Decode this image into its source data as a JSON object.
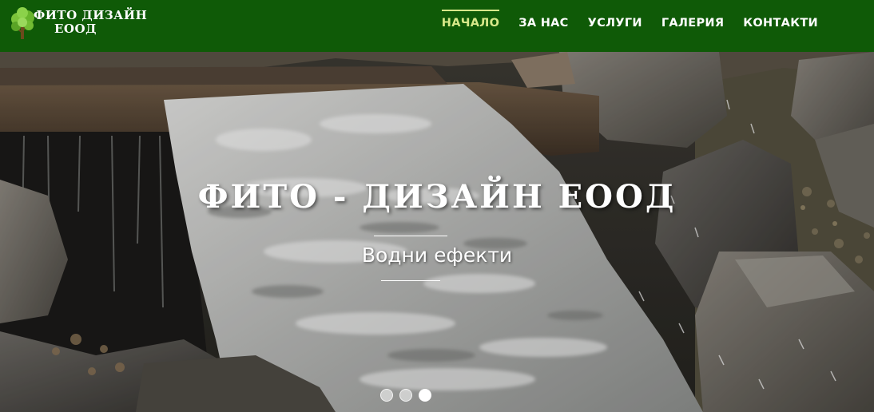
{
  "header": {
    "background": "#0f5a07",
    "logo": {
      "line1": "ФИТО ДИЗАЙН",
      "line2": "ЕООД",
      "icon": "tree-icon"
    },
    "nav": {
      "items": [
        {
          "label": "НАЧАЛО",
          "active": true
        },
        {
          "label": "ЗА НАС",
          "active": false
        },
        {
          "label": "УСЛУГИ",
          "active": false
        },
        {
          "label": "ГАЛЕРИЯ",
          "active": false
        },
        {
          "label": "КОНТАКТИ",
          "active": false
        }
      ],
      "active_color": "#d7e889"
    }
  },
  "hero": {
    "title": "Фито - дизайн ЕООД",
    "subtitle": "Водни ефекти",
    "slides": {
      "count": 3,
      "active_index": 3
    }
  }
}
